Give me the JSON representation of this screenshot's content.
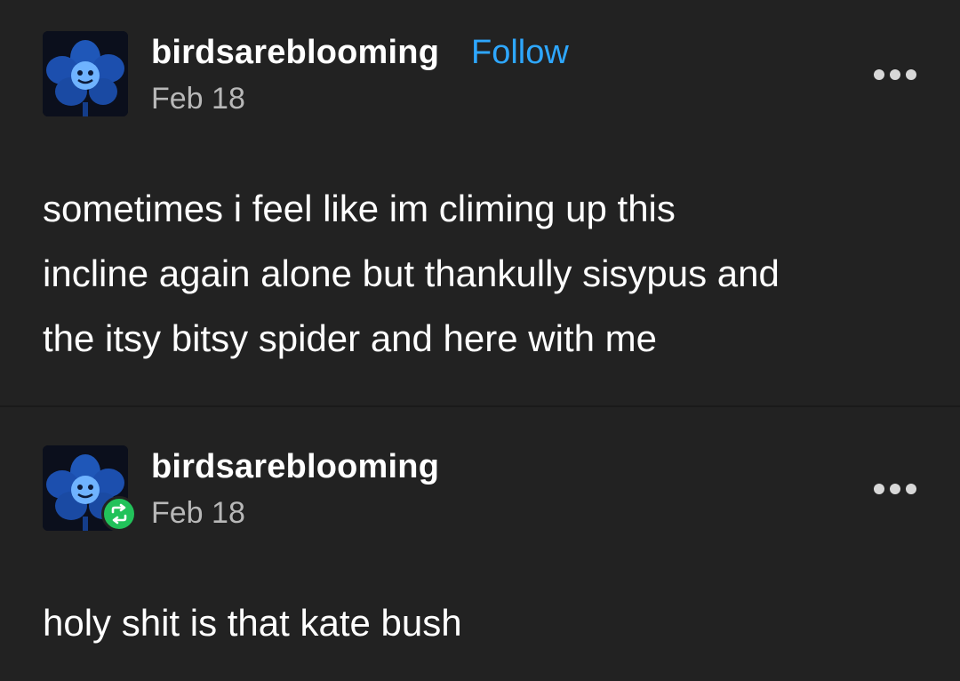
{
  "posts": [
    {
      "username": "birdsareblooming",
      "follow_label": "Follow",
      "date": "Feb 18",
      "text": "sometimes i feel like im climing up this\nincline again alone but thankully sisypus and\nthe itsy bitsy spider and here with me"
    },
    {
      "username": "birdsareblooming",
      "date": "Feb 18",
      "text": "holy shit is that kate bush",
      "badge": "reblog-icon"
    }
  ],
  "icons": {
    "avatar": "blue-flower-avatar",
    "more": "more-options-icon"
  },
  "colors": {
    "background": "#222222",
    "text": "#ffffff",
    "secondary_text": "#b8b8b8",
    "follow_accent": "#2ea7ff",
    "reblog_badge": "#22c25a"
  }
}
